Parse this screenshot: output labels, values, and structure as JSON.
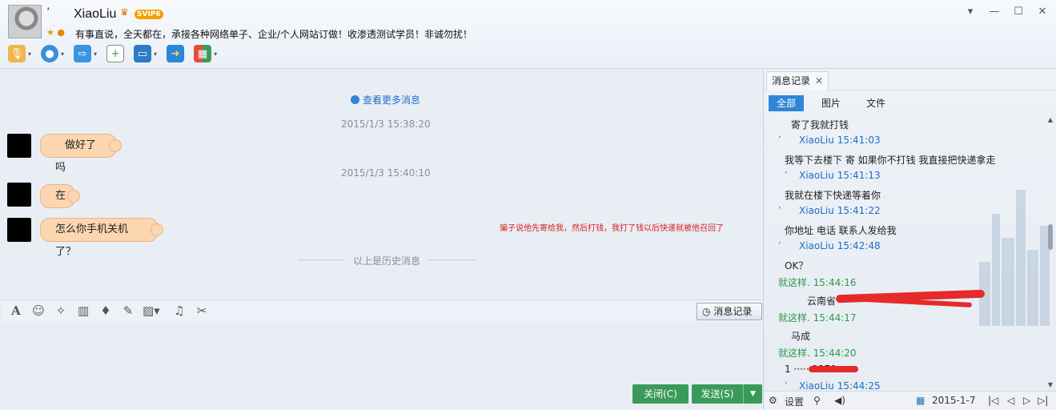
{
  "header": {
    "quote": "’",
    "nickname": "XiaoLiu",
    "vip_badge": "SVIP6",
    "signature": "有事直说，全天都在，承接各种网络单子、企业/个人网站订做！收渗透测试学员！非诚勿扰！",
    "window_buttons": [
      "▾",
      "—",
      "☐",
      "✕"
    ],
    "toolbar_icons": [
      "microphone-icon",
      "camera-icon",
      "folder-transfer-icon",
      "add-chat-icon",
      "remote-desktop-icon",
      "screen-share-icon",
      "apps-grid-icon"
    ]
  },
  "chat": {
    "view_more": "查看更多消息",
    "messages": [
      {
        "time": "2015/1/3 15:38:20",
        "text": "做好了吗"
      },
      {
        "time": "2015/1/3 15:40:10",
        "text": "在"
      },
      {
        "time": "",
        "text": "怎么你手机关机了？"
      }
    ],
    "red_note": "骗子说他先寄给我，然后打钱，我打了钱以后快递就被他召回了",
    "history_divider": "以上是历史消息"
  },
  "input": {
    "history_button": "消息记录",
    "close_button": "关闭(C)",
    "send_button": "发送(S)"
  },
  "panel": {
    "tab_label": "消息记录",
    "filters": [
      "全部",
      "图片",
      "文件"
    ],
    "entries": [
      {
        "text": "寄了我就打钱"
      },
      {
        "head": "XiaoLiu 15:41:03",
        "color": "blue"
      },
      {
        "text": "我等下去楼下  寄 如果你不打钱 我直接把快递拿走"
      },
      {
        "head": "XiaoLiu 15:41:13",
        "color": "blue"
      },
      {
        "text": "我就在楼下快递等着你"
      },
      {
        "head": "XiaoLiu 15:41:22",
        "color": "blue"
      },
      {
        "text": "你地址 电话 联系人发给我"
      },
      {
        "head": "XiaoLiu 15:42:48",
        "color": "blue"
      },
      {
        "text": "OK？"
      },
      {
        "head": "就这样. 15:44:16",
        "color": "green"
      },
      {
        "text": "云南省 ··· ···"
      },
      {
        "head": "就这样. 15:44:17",
        "color": "green"
      },
      {
        "text": "马成"
      },
      {
        "head": "就这样. 15:44:20",
        "color": "green"
      },
      {
        "text": "1 ······2270"
      },
      {
        "head": "XiaoLiu 15:44:25",
        "color": "blue"
      }
    ],
    "footer": {
      "settings": "设置",
      "date": "2015-1-7"
    }
  },
  "colors": {
    "accent_blue": "#2f86d6",
    "send_green": "#3a9b59",
    "bubble": "#fbd6b0",
    "warning_red": "#d62020"
  }
}
